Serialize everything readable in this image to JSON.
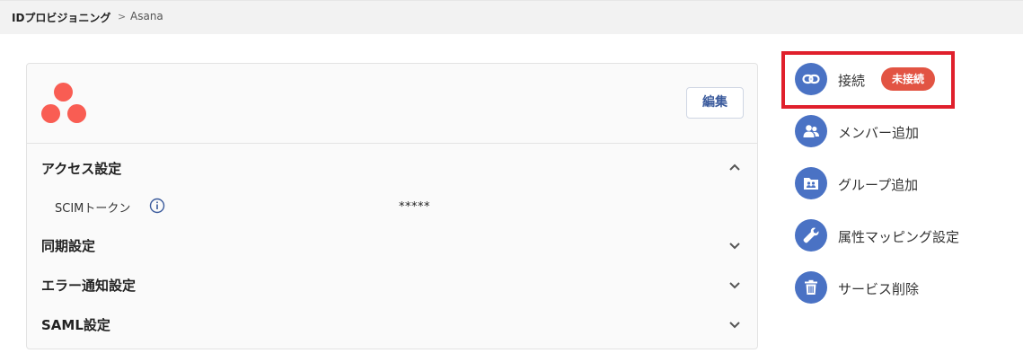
{
  "breadcrumb": {
    "root": "IDプロビジョニング",
    "separator": ">",
    "current": "Asana"
  },
  "card": {
    "logo": "asana-logo",
    "edit_label": "編集",
    "sections": [
      {
        "title": "アクセス設定",
        "expanded": true
      },
      {
        "title": "同期設定",
        "expanded": false
      },
      {
        "title": "エラー通知設定",
        "expanded": false
      },
      {
        "title": "SAML設定",
        "expanded": false
      }
    ],
    "fields": [
      {
        "label": "SCIMトークン",
        "value": "*****"
      }
    ]
  },
  "actions": [
    {
      "label": "接続",
      "icon": "link-icon",
      "badge": "未接続"
    },
    {
      "label": "メンバー追加",
      "icon": "people-icon"
    },
    {
      "label": "グループ追加",
      "icon": "group-folder-icon"
    },
    {
      "label": "属性マッピング設定",
      "icon": "wrench-icon"
    },
    {
      "label": "サービス削除",
      "icon": "trash-icon"
    }
  ],
  "colors": {
    "accent": "#4a72c4",
    "logo": "#f95d53",
    "badge": "#e25443",
    "highlight": "#e0202c"
  }
}
